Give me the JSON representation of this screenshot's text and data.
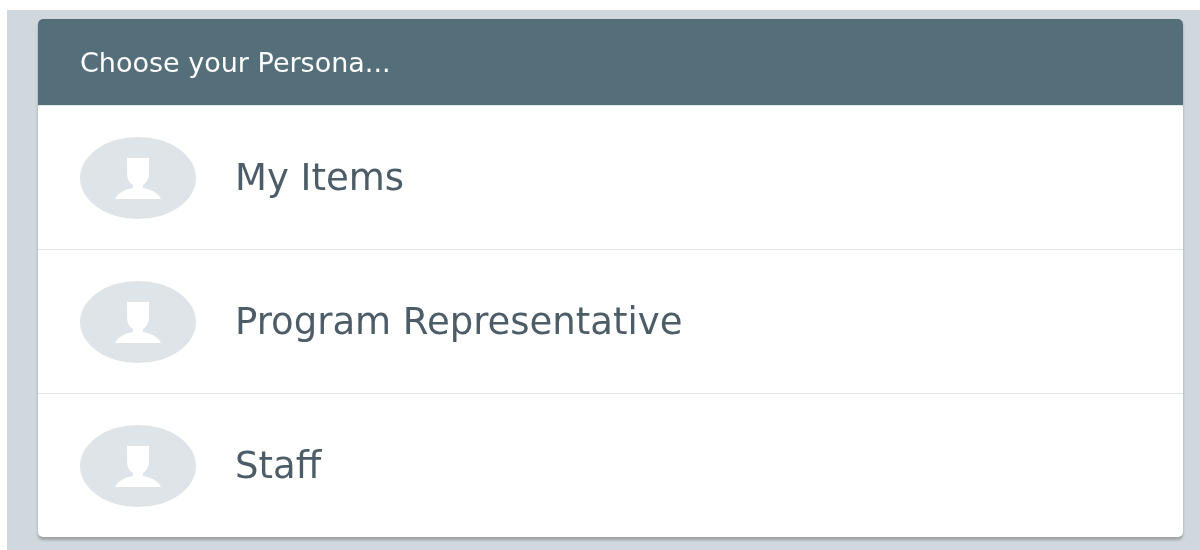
{
  "panel": {
    "title": "Choose your Persona..."
  },
  "personas": [
    {
      "label": "My Items"
    },
    {
      "label": "Program Representative"
    },
    {
      "label": "Staff"
    }
  ]
}
